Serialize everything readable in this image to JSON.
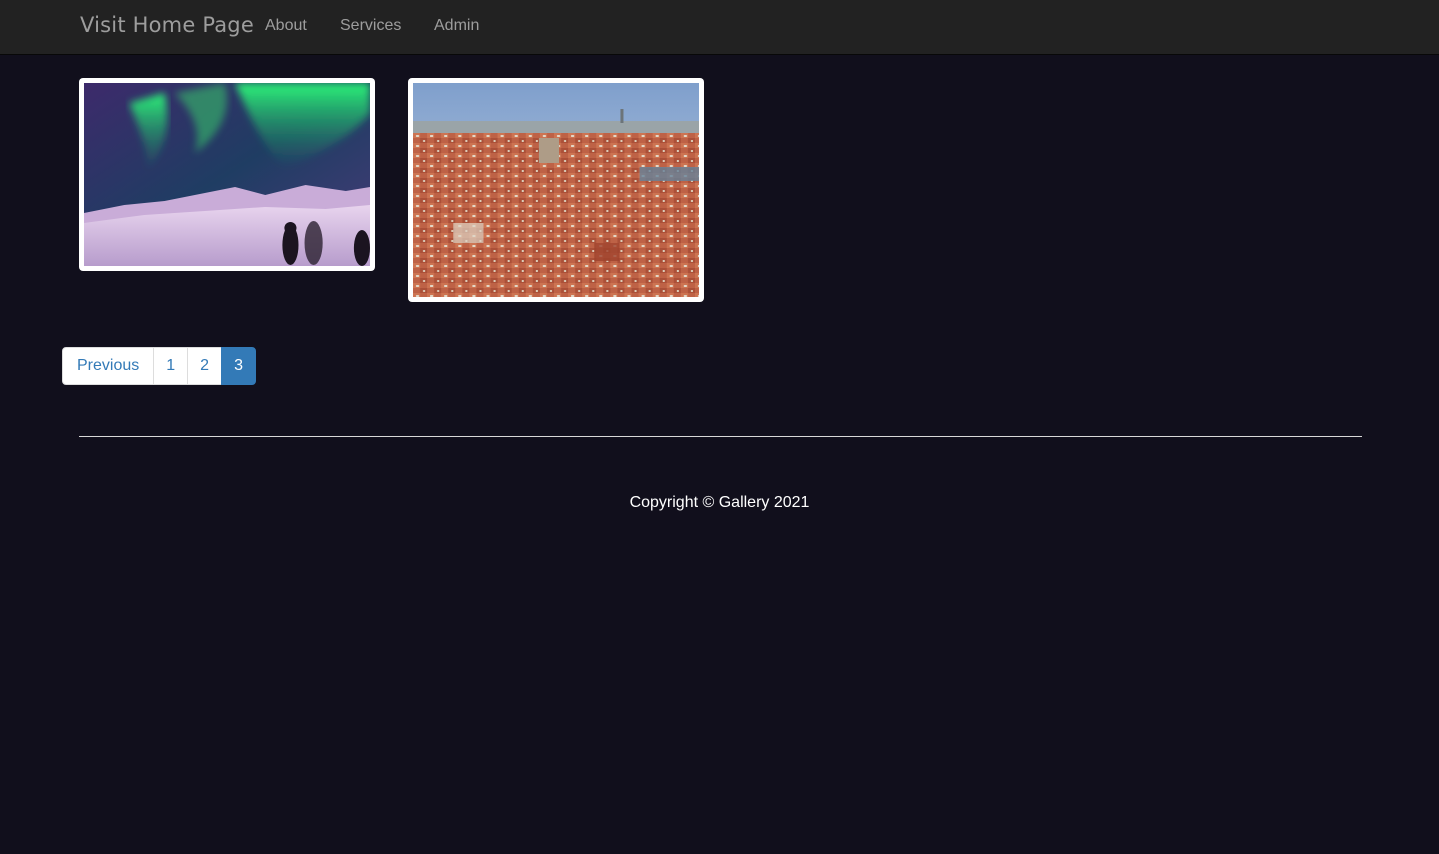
{
  "navbar": {
    "brand": "Visit Home Page",
    "links": [
      "About",
      "Services",
      "Admin"
    ]
  },
  "gallery": {
    "images": [
      {
        "icon": "aurora-photo",
        "subject": "Northern lights over snowy mountains"
      },
      {
        "icon": "city-photo",
        "subject": "Aerial view of red-roofed old city"
      }
    ]
  },
  "pagination": {
    "previous": "Previous",
    "pages": [
      "1",
      "2",
      "3"
    ],
    "active": "3"
  },
  "footer": {
    "copyright": "Copyright © Gallery 2021"
  },
  "colors": {
    "background": "#110f1c",
    "navbar": "#222222",
    "nav_text": "#9d9d9d",
    "link": "#337ab7",
    "active_page": "#337ab7"
  }
}
